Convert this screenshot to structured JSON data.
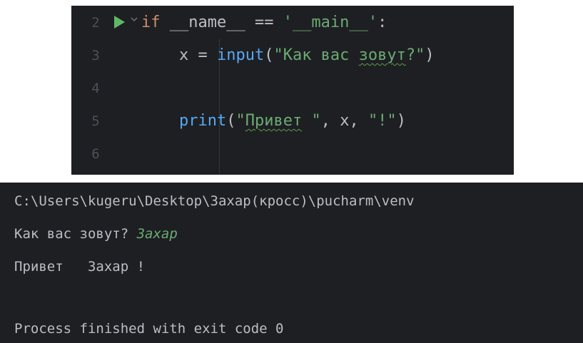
{
  "editor": {
    "lines": [
      {
        "number": "2",
        "tokens": [
          {
            "text": "if",
            "cls": "kw"
          },
          {
            "text": " __name__ == ",
            "cls": "id"
          },
          {
            "text": "'__main__'",
            "cls": "str"
          },
          {
            "text": ":",
            "cls": "id"
          }
        ]
      },
      {
        "number": "3",
        "tokens": [
          {
            "text": "    x = ",
            "cls": "id"
          },
          {
            "text": "input",
            "cls": "fn"
          },
          {
            "text": "(",
            "cls": "id"
          },
          {
            "text": "\"Как вас ",
            "cls": "str"
          },
          {
            "text": "зовут",
            "cls": "str typo"
          },
          {
            "text": "?\"",
            "cls": "str"
          },
          {
            "text": ")",
            "cls": "id"
          }
        ]
      },
      {
        "number": "4",
        "tokens": []
      },
      {
        "number": "5",
        "tokens": [
          {
            "text": "    ",
            "cls": "id"
          },
          {
            "text": "print",
            "cls": "fn"
          },
          {
            "text": "(",
            "cls": "id"
          },
          {
            "text": "\"",
            "cls": "str"
          },
          {
            "text": "Привет",
            "cls": "str typo"
          },
          {
            "text": " \"",
            "cls": "str"
          },
          {
            "text": ", x, ",
            "cls": "id"
          },
          {
            "text": "\"!\"",
            "cls": "str"
          },
          {
            "text": ")",
            "cls": "id"
          }
        ]
      },
      {
        "number": "6",
        "tokens": []
      }
    ],
    "run_icon": "run-triangle-icon",
    "fold_icon": "fold-chevron-icon"
  },
  "console": {
    "path": "C:\\Users\\kugeru\\Desktop\\Захар(кросс)\\pucharm\\venv",
    "prompt": "Как вас зовут? ",
    "input_value": "Захар",
    "greeting": "Привет   Захар !",
    "exit_message": "Process finished with exit code 0"
  },
  "colors": {
    "background": "#1e1f22",
    "keyword": "#cf8e6d",
    "function": "#56a8f5",
    "string": "#6aab73",
    "text": "#bcbec4",
    "line_number": "#4b5059",
    "run_icon": "#5fb865"
  }
}
